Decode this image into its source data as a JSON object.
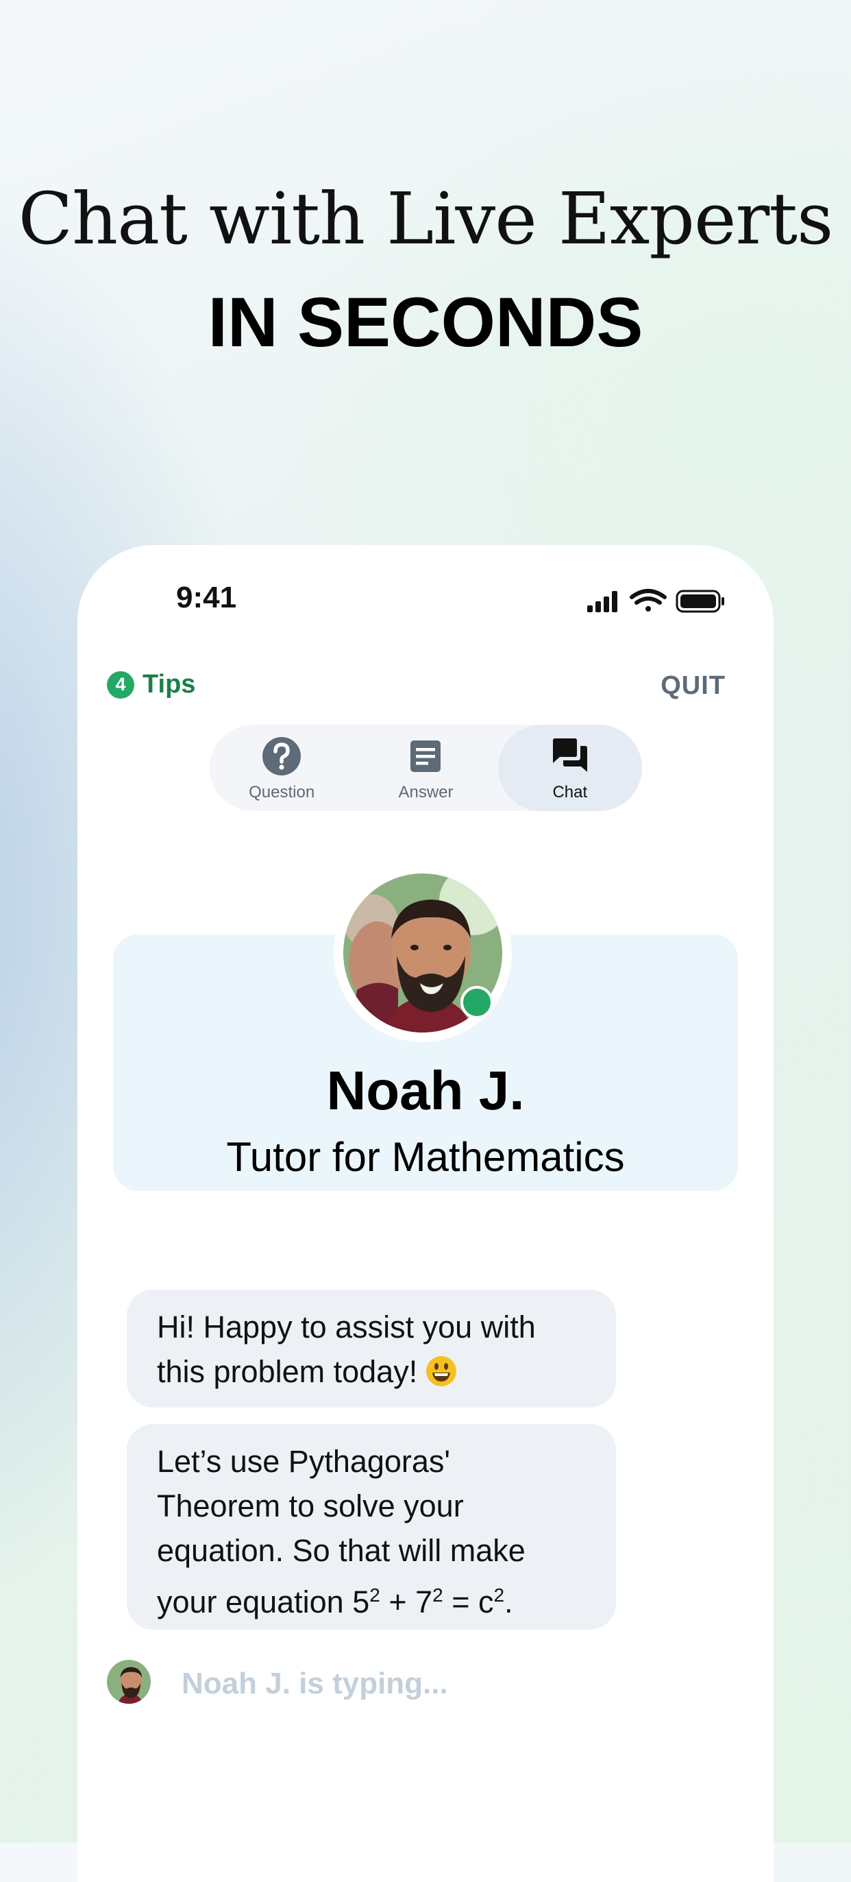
{
  "marketing": {
    "headline": "Chat with Live Experts",
    "subheadline": "IN SECONDS"
  },
  "status_bar": {
    "time": "9:41",
    "icons": [
      "signal-icon",
      "wifi-icon",
      "battery-icon"
    ]
  },
  "header": {
    "tips_count": "4",
    "tips_label": "Tips",
    "quit_label": "QUIT"
  },
  "tabs": [
    {
      "label": "Question",
      "icon": "question-circle-icon",
      "active": false
    },
    {
      "label": "Answer",
      "icon": "document-icon",
      "active": false
    },
    {
      "label": "Chat",
      "icon": "chat-bubbles-icon",
      "active": true
    }
  ],
  "tutor": {
    "name": "Noah J.",
    "role": "Tutor for Mathematics",
    "online": true
  },
  "messages": [
    {
      "line1": "Hi! Happy to assist you with",
      "line2": "this problem today!",
      "emoji": "grinning-face"
    },
    {
      "line1": "Let’s use Pythagoras'",
      "line2": "Theorem to solve your",
      "line3": "equation. So that will make",
      "line4_a": "your equation 5",
      "sup1": "2",
      "line4_b": " + 7",
      "sup2": "2",
      "line4_c": " = c",
      "sup3": "2",
      "line4_d": "."
    }
  ],
  "typing": {
    "text": "Noah J. is typing..."
  },
  "colors": {
    "accent_green": "#24a866",
    "tips_green": "#1c7f4a",
    "quit_gray": "#5d6a78",
    "card_blue": "#ebf6fc",
    "bubble_gray": "#edf1f6",
    "typing_gray": "#c3cfdb"
  }
}
